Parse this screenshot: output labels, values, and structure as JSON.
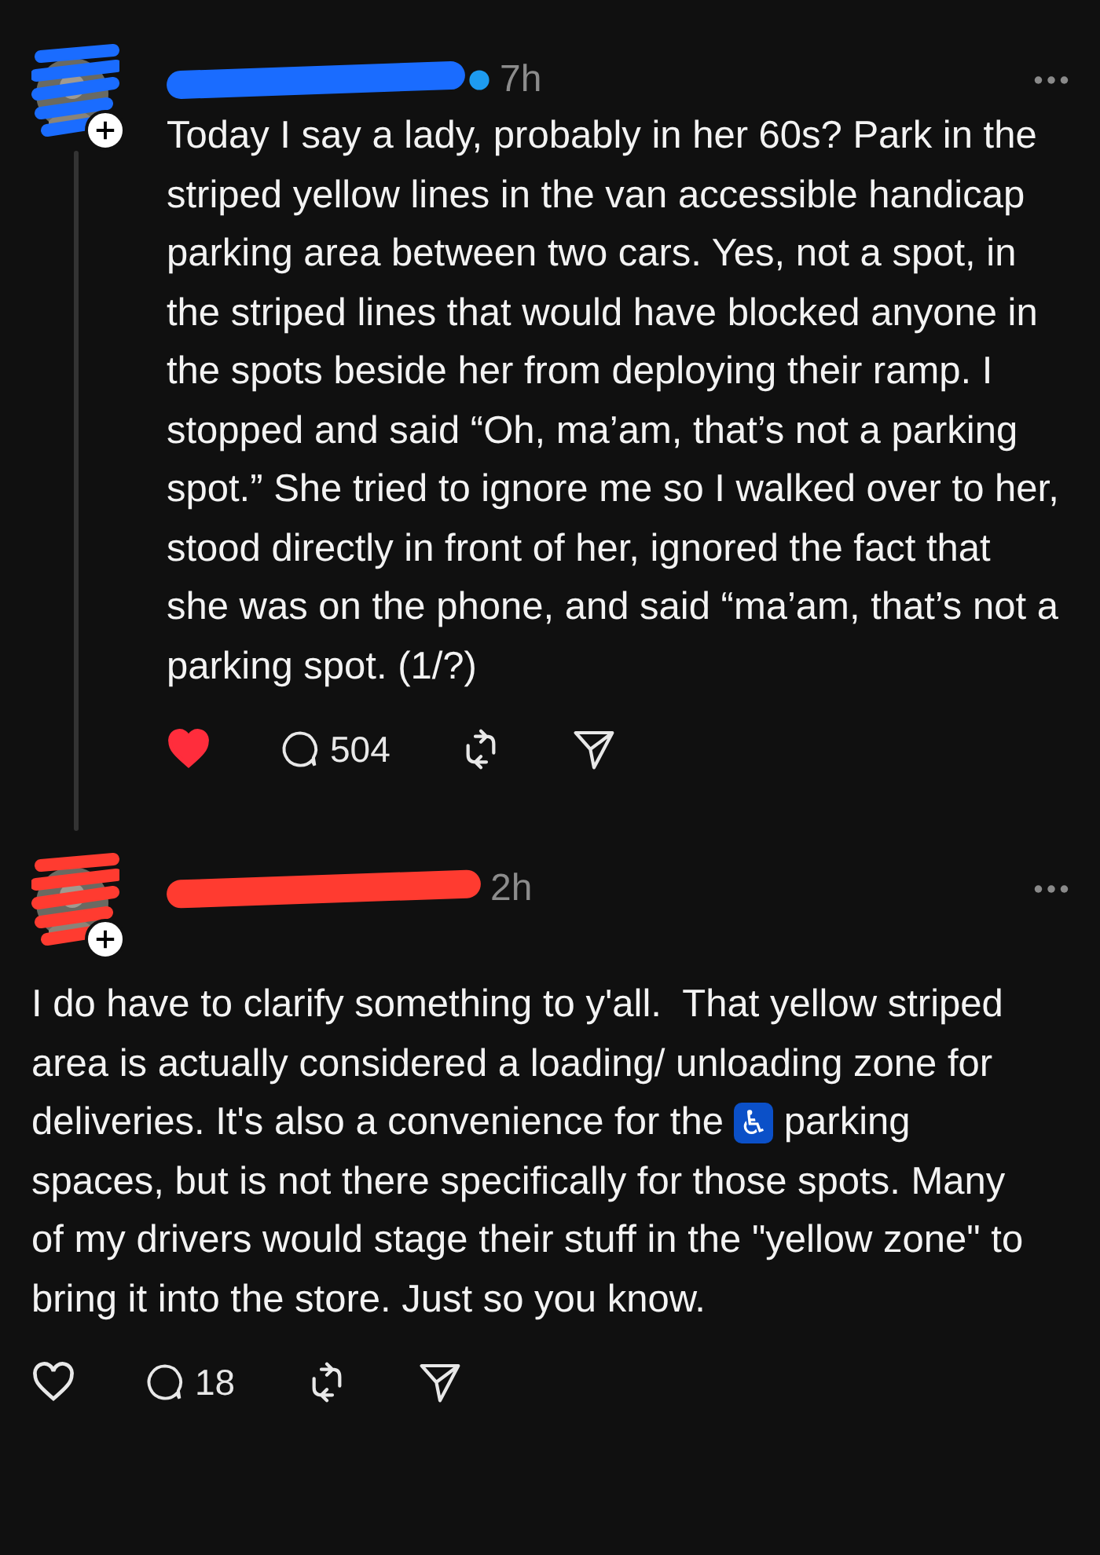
{
  "posts": [
    {
      "time": "7h",
      "verified": true,
      "color": "#1a6cff",
      "body": [
        {
          "kind": "text",
          "text": "Today I say a lady, probably in her 60s? Park in the striped yellow lines in the van accessible handicap parking area between two cars. Yes, not a spot, in the striped lines that would have blocked anyone in the spots beside her from deploying their ramp. I stopped and said “Oh, ma’am, that’s not a parking spot.” She tried to ignore me so I walked over to her, stood directly in front of her, ignored the fact that she was on the phone, and said “ma’am, that’s not a parking spot. (1/?)"
        }
      ],
      "liked": true,
      "replies": "504"
    },
    {
      "time": "2h",
      "verified": false,
      "color": "#ff3b30",
      "body": [
        {
          "kind": "text",
          "text": "I do have to clarify something to y'all.  That yellow striped area is actually considered a loading/ unloading zone for deliveries. It's also a convenience for the "
        },
        {
          "kind": "emoji",
          "text": "♿"
        },
        {
          "kind": "text",
          "text": " parking spaces, but is not there specifically for those spots. Many of my drivers would stage their stuff in the \"yellow zone\" to bring it into the store. Just so you know."
        }
      ],
      "liked": false,
      "replies": "18"
    }
  ]
}
